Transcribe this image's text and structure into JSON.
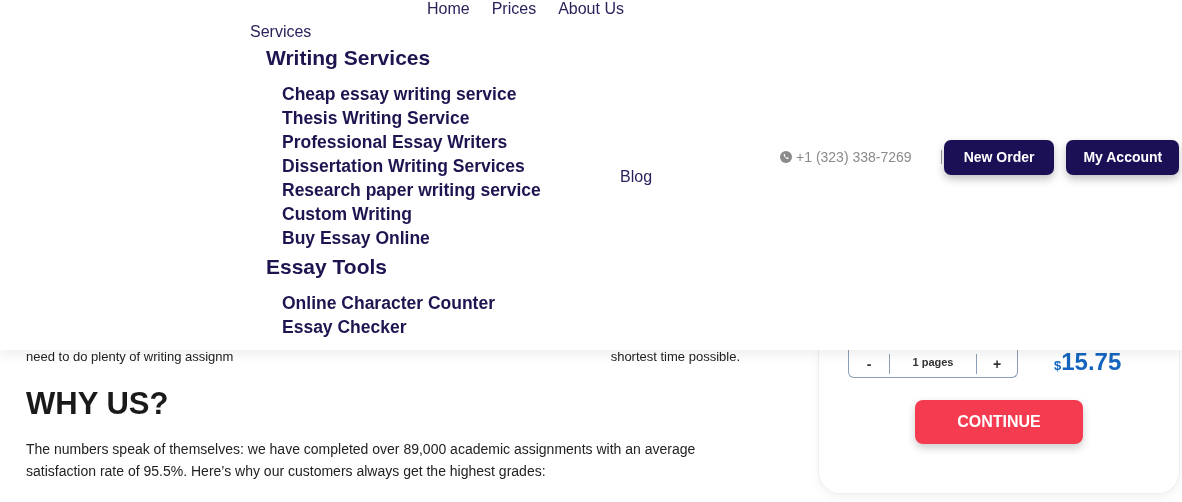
{
  "top_nav": [
    "Home",
    "Prices",
    "About Us"
  ],
  "services_menu": {
    "label": "Services",
    "groups": [
      {
        "title": "Writing Services",
        "items": [
          "Cheap essay writing service",
          "Thesis Writing Service",
          "Professional Essay Writers",
          "Dissertation Writing Services",
          "Research paper writing service",
          "Custom Writing",
          "Buy Essay Online"
        ]
      },
      {
        "title": "Essay Tools",
        "items": [
          "Online Character Counter",
          "Essay Checker"
        ]
      }
    ]
  },
  "blog": "Blog",
  "phone": "+1 (323) 338-7269",
  "header_buttons": [
    "New Order",
    "My Account"
  ],
  "intro_fragments": [
    "need to do plenty of writing assignm",
    "shortest time possible."
  ],
  "why_us": {
    "title": "WHY US?",
    "text": "The numbers speak of themselves: we have completed over 89,000 academic assignments with an average satisfaction rate of 95.5%. Here’s why our customers always get the highest grades:"
  },
  "order": {
    "decrement": "-",
    "pages": "1 pages",
    "increment": "+",
    "price_currency": "$",
    "price": "15.75",
    "button": "CONTINUE"
  }
}
